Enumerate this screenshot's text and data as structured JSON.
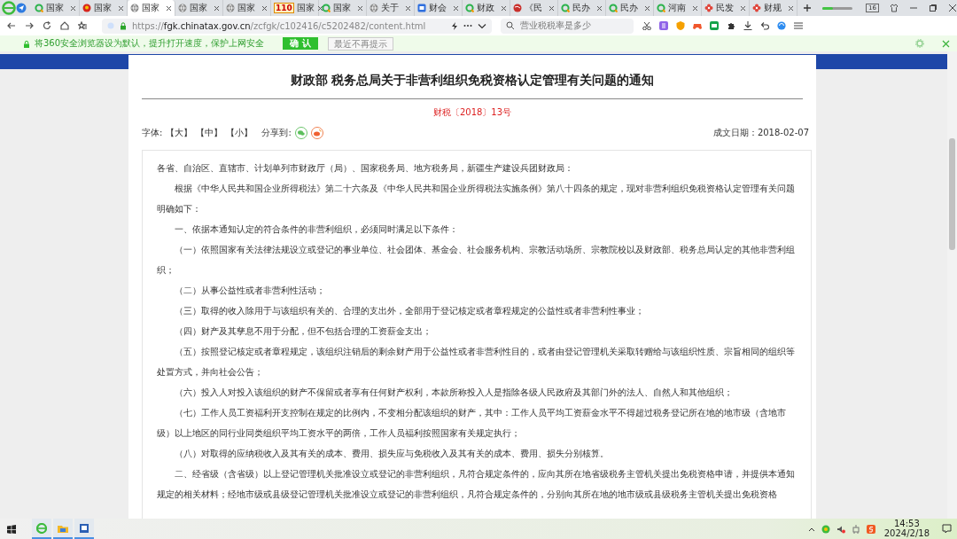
{
  "browser": {
    "tabs": [
      {
        "label": "国家",
        "kind": "ring",
        "selected": false
      },
      {
        "label": "国家",
        "kind": "emblem",
        "selected": false
      },
      {
        "label": "国家",
        "kind": "globe",
        "selected": true
      },
      {
        "label": "国家",
        "kind": "globe",
        "selected": false
      },
      {
        "label": "国家",
        "kind": "globe",
        "selected": false
      },
      {
        "label": "国家",
        "kind": "badge",
        "badge": "110",
        "selected": false
      },
      {
        "label": "国家",
        "kind": "ring",
        "selected": false
      },
      {
        "label": "关于",
        "kind": "globe",
        "selected": false
      },
      {
        "label": "财会",
        "kind": "square",
        "selected": false
      },
      {
        "label": "财政",
        "kind": "ring",
        "selected": false
      },
      {
        "label": "《民",
        "kind": "sphere",
        "selected": false
      },
      {
        "label": "民办",
        "kind": "ring",
        "selected": false
      },
      {
        "label": "民办",
        "kind": "ring",
        "selected": false
      },
      {
        "label": "河南",
        "kind": "ring",
        "selected": false
      },
      {
        "label": "民发",
        "kind": "flower",
        "selected": false
      },
      {
        "label": "财规",
        "kind": "flower",
        "selected": false
      }
    ],
    "tab_count": "16",
    "url": "https://**fgk.chinatax.gov.cn**/zcfgk/c102416/c5202482/content.html",
    "search": {
      "placeholder": "营业税税率是多少"
    },
    "notice": {
      "text": "将360安全浏览器设为默认，提升打开速度，保护上网安全",
      "confirm": "确 认",
      "dismiss": "最近不再提示"
    }
  },
  "article": {
    "title": "财政部 税务总局关于非营利组织免税资格认定管理有关问题的通知",
    "doc_number": "财税〔2018〕13号",
    "font_label": "字体:",
    "font_sizes": [
      "【大】",
      "【中】",
      "【小】"
    ],
    "share_label": "分享到:",
    "date": "成文日期：2018-02-07",
    "paragraphs": [
      {
        "indent": false,
        "text": "各省、自治区、直辖市、计划单列市财政厅（局）、国家税务局、地方税务局，新疆生产建设兵团财政局："
      },
      {
        "indent": true,
        "text": "根据《中华人民共和国企业所得税法》第二十六条及《中华人民共和国企业所得税法实施条例》第八十四条的规定，现对非营利组织免税资格认定管理有关问题明确如下："
      },
      {
        "indent": true,
        "text": "一、依据本通知认定的符合条件的非营利组织，必须同时满足以下条件："
      },
      {
        "indent": true,
        "text": "（一）依照国家有关法律法规设立或登记的事业单位、社会团体、基金会、社会服务机构、宗教活动场所、宗教院校以及财政部、税务总局认定的其他非营利组织；"
      },
      {
        "indent": true,
        "text": "（二）从事公益性或者非营利性活动；"
      },
      {
        "indent": true,
        "text": "（三）取得的收入除用于与该组织有关的、合理的支出外，全部用于登记核定或者章程规定的公益性或者非营利性事业；"
      },
      {
        "indent": true,
        "text": "（四）财产及其孳息不用于分配，但不包括合理的工资薪金支出；"
      },
      {
        "indent": true,
        "text": "（五）按照登记核定或者章程规定，该组织注销后的剩余财产用于公益性或者非营利性目的，或者由登记管理机关采取转赠给与该组织性质、宗旨相同的组织等处置方式，并向社会公告；"
      },
      {
        "indent": true,
        "text": "（六）投入人对投入该组织的财产不保留或者享有任何财产权利，本款所称投入人是指除各级人民政府及其部门外的法人、自然人和其他组织；"
      },
      {
        "indent": true,
        "text": "（七）工作人员工资福利开支控制在规定的比例内，不变相分配该组织的财产，其中：工作人员平均工资薪金水平不得超过税务登记所在地的地市级（含地市级）以上地区的同行业同类组织平均工资水平的两倍，工作人员福利按照国家有关规定执行；"
      },
      {
        "indent": true,
        "text": "（八）对取得的应纳税收入及其有关的成本、费用、损失应与免税收入及其有关的成本、费用、损失分别核算。"
      },
      {
        "indent": true,
        "text": "二、经省级（含省级）以上登记管理机关批准设立或登记的非营利组织，凡符合规定条件的，应向其所在地省级税务主管机关提出免税资格申请，并提供本通知规定的相关材料；经地市级或县级登记管理机关批准设立或登记的非营利组织，凡符合规定条件的，分别向其所在地的地市级或县级税务主管机关提出免税资格"
      }
    ]
  },
  "taskbar": {
    "time": "14:53",
    "date": "2024/2/18"
  }
}
